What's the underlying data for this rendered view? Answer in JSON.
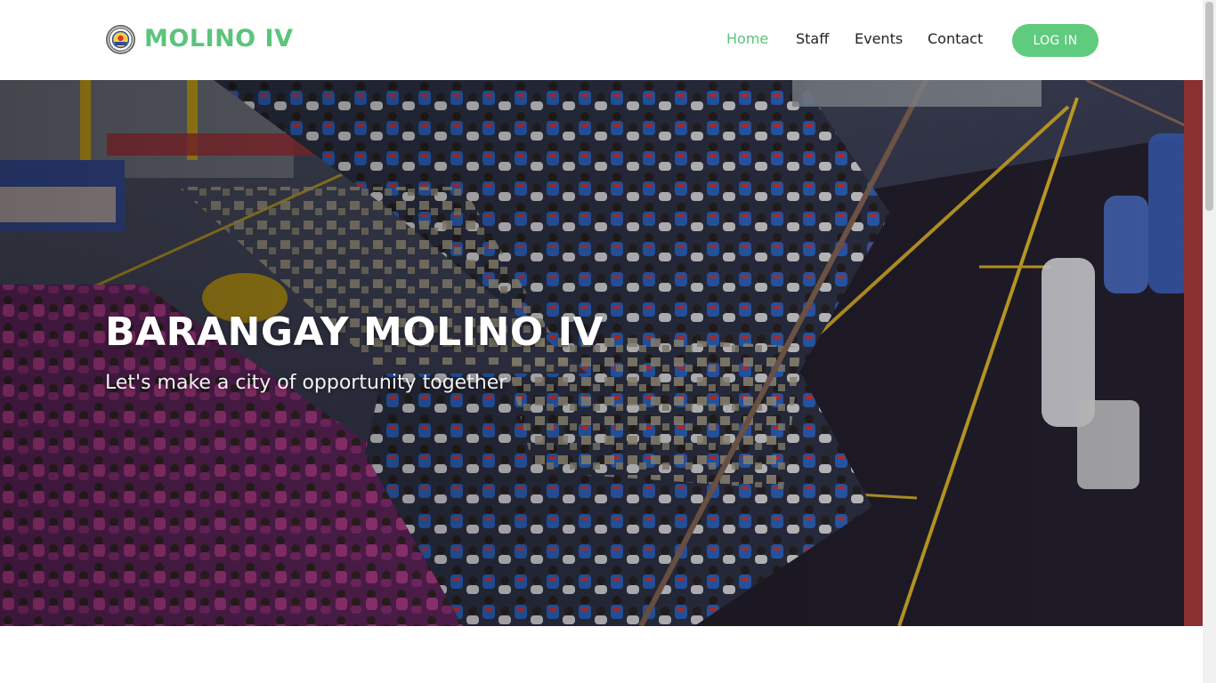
{
  "brand": {
    "name": "MOLINO IV",
    "seal_icon": "barangay-seal-icon",
    "color": "#5bc47a"
  },
  "nav": {
    "items": [
      {
        "label": "Home",
        "active": true
      },
      {
        "label": "Staff",
        "active": false
      },
      {
        "label": "Events",
        "active": false
      },
      {
        "label": "Contact",
        "active": false
      }
    ],
    "login_label": "LOG IN"
  },
  "hero": {
    "title": "BARANGAY MOLINO IV",
    "subtitle": "Let's make a city of opportunity together"
  },
  "colors": {
    "accent": "#5bc47a",
    "button": "#5fcb7e",
    "nav_text": "#222222"
  }
}
